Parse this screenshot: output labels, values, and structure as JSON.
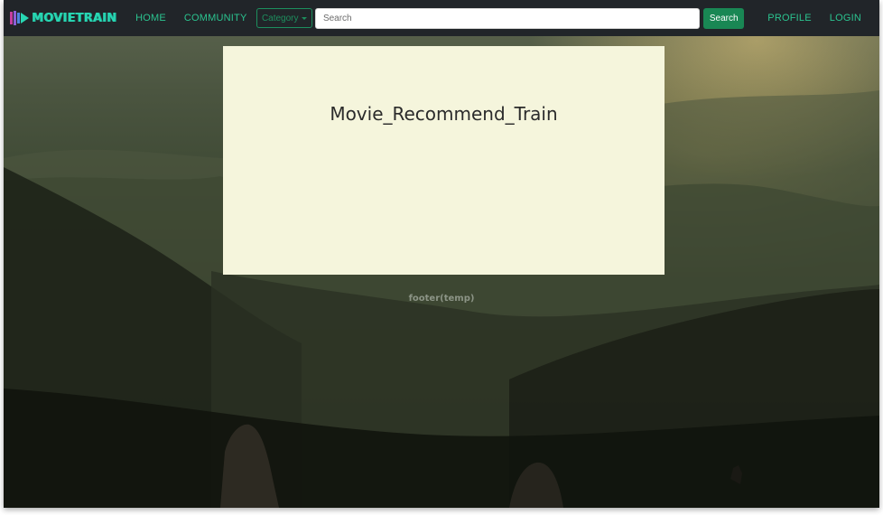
{
  "navbar": {
    "brand": "MOVIETRAIN",
    "links": [
      "HOME",
      "COMMUNITY"
    ],
    "category_label": "Category",
    "search_placeholder": "Search",
    "search_button": "Search",
    "right_links": [
      "PROFILE",
      "LOGIN"
    ]
  },
  "hero": {
    "title": "Movie_Recommend_Train"
  },
  "footer": {
    "text": "footer(temp)"
  },
  "colors": {
    "navbar_bg": "#212529",
    "accent_green": "#198754",
    "link_green": "#2bc38f",
    "hero_bg": "#f5f5dc"
  }
}
